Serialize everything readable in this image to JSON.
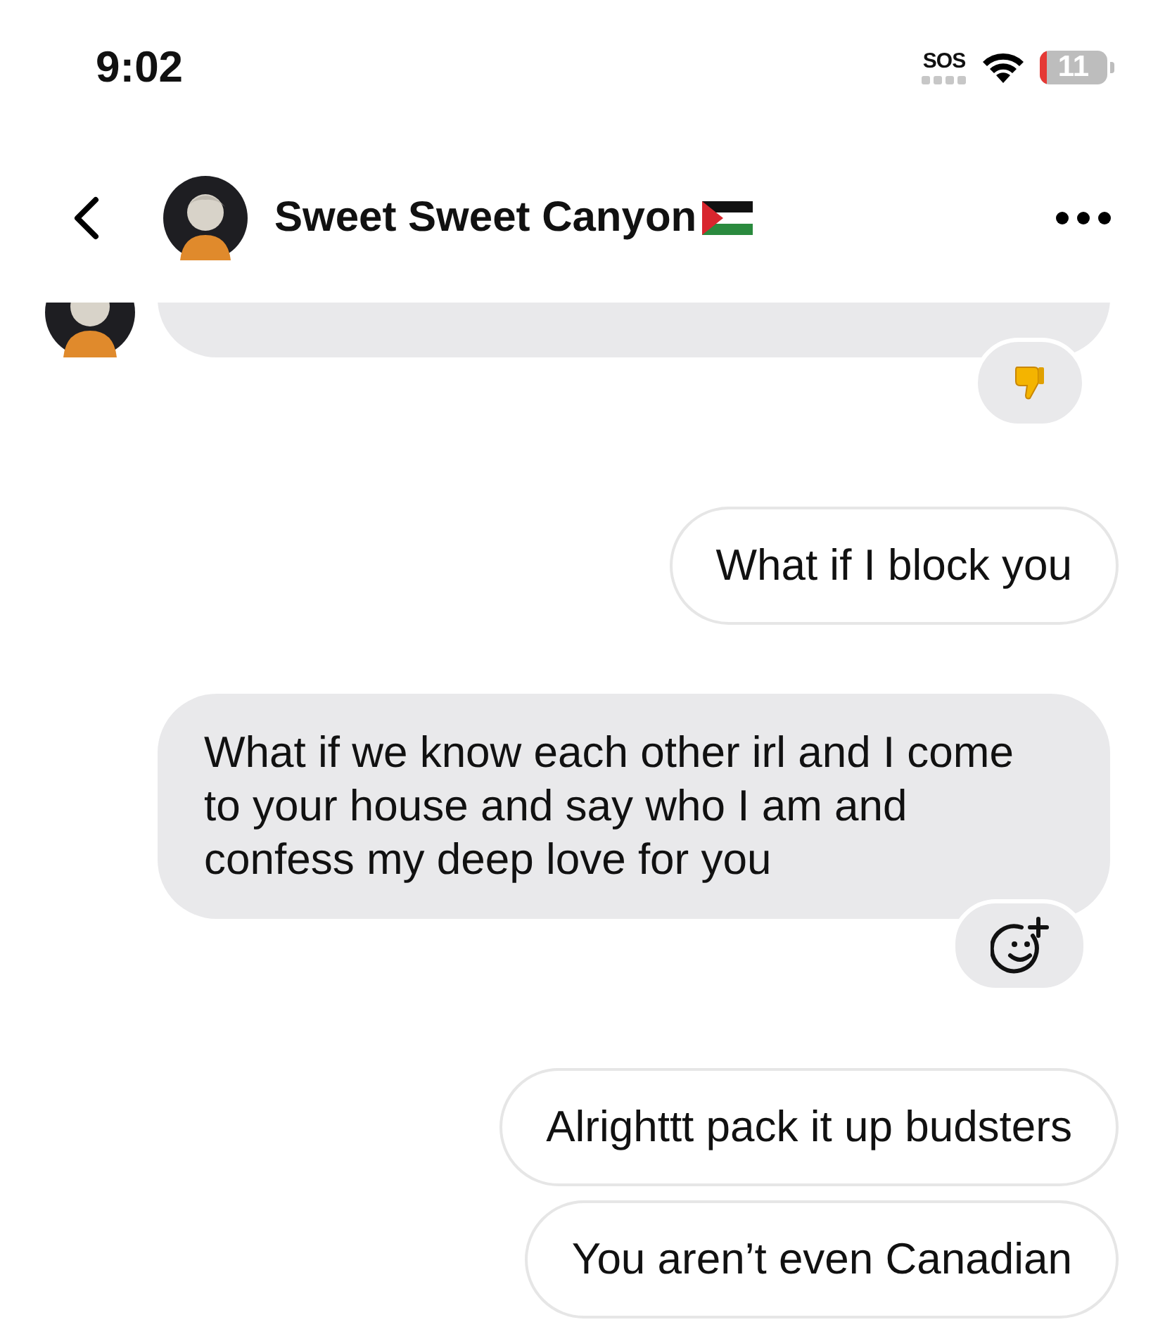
{
  "status_bar": {
    "time": "9:02",
    "sos": "SOS",
    "battery": "11"
  },
  "header": {
    "title": "Sweet Sweet Canyon"
  },
  "messages": [
    {
      "kind": "incoming",
      "avatar": true,
      "reaction": {
        "kind": "thumbs_down"
      }
    },
    {
      "kind": "outgoing",
      "text": "What if I block you"
    },
    {
      "kind": "incoming",
      "text": "What if we know each other irl and I come to your house and say who I am and confess my deep love for you",
      "avatar": false,
      "reaction": {
        "kind": "add"
      }
    },
    {
      "kind": "outgoing",
      "text": "Alrighttt pack it up budsters"
    },
    {
      "kind": "outgoing",
      "text": "You aren’t even Canadian"
    }
  ]
}
